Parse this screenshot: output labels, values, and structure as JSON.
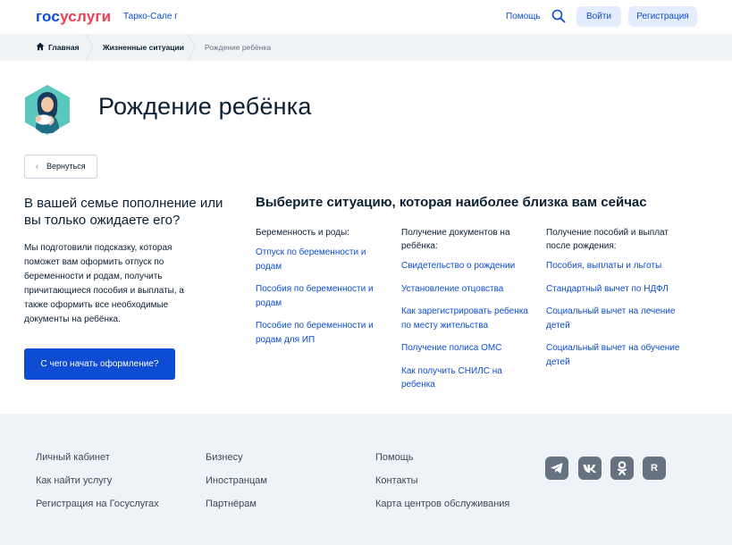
{
  "header": {
    "logo_part1": "гос",
    "logo_part2": "услуги",
    "city": "Тарко-Сале г",
    "help": "Помощь",
    "login": "Войти",
    "register": "Регистрация"
  },
  "breadcrumbs": {
    "home": "Главная",
    "section": "Жизненные ситуации",
    "current": "Рождение ребёнка"
  },
  "page": {
    "title": "Рождение ребёнка",
    "back": "Вернуться"
  },
  "intro": {
    "title": "В вашей семье пополнение или вы только ожидаете его?",
    "text": "Мы подготовили подсказку, которая поможет вам оформить отпуск по беременности и родам, получить причитающиеся пособия и выплаты, а также оформить все необходимые документы на ребёнка.",
    "button": "С чего начать оформление?"
  },
  "situations": {
    "title": "Выберите ситуацию, которая наиболее близка вам сейчас",
    "columns": [
      {
        "heading": "Беременность и роды:",
        "links": [
          "Отпуск по беременности и родам",
          "Пособия по беременности и родам",
          "Пособие по беременности и родам для ИП"
        ]
      },
      {
        "heading": "Получение документов на ребёнка:",
        "links": [
          "Свидетельство о рождении",
          "Установление отцовства",
          "Как зарегистрировать ребенка по месту жительства",
          "Получение полиса ОМС",
          "Как получить СНИЛС на ребенка"
        ]
      },
      {
        "heading": "Получение пособий и выплат после рождения:",
        "links": [
          "Пособия, выплаты и льготы",
          "Стандартный вычет по НДФЛ",
          "Социальный вычет на лечение детей",
          "Социальный вычет на обучение детей"
        ]
      }
    ]
  },
  "footer": {
    "col1": [
      "Личный кабинет",
      "Как найти услугу",
      "Регистрация на Госуслугах"
    ],
    "col2": [
      "Бизнесу",
      "Иностранцам",
      "Партнёрам"
    ],
    "col3": [
      "Помощь",
      "Контакты",
      "Карта центров обслуживания"
    ],
    "social": [
      "telegram-icon",
      "vk-icon",
      "odnoklassniki-icon",
      "rutube-icon"
    ],
    "rutube_letter": "R"
  },
  "colors": {
    "brand_blue": "#0d4cd3",
    "brand_red": "#ee3f58",
    "footer_bg": "#eef3f7"
  }
}
